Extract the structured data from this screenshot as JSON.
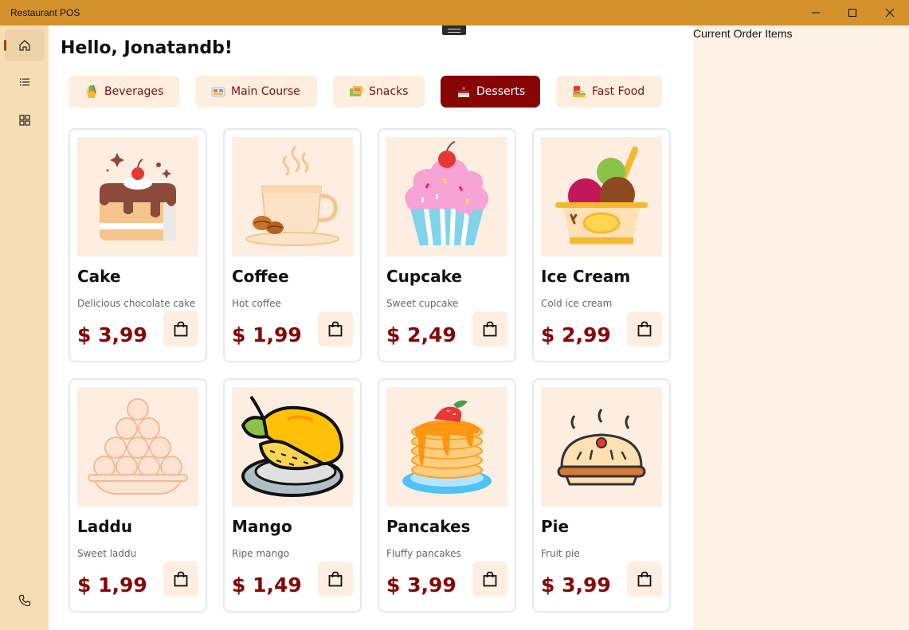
{
  "window": {
    "title": "Restaurant POS"
  },
  "header": {
    "greeting": "Hello, Jonatandb!"
  },
  "nav": [
    {
      "name": "home",
      "active": true
    },
    {
      "name": "list",
      "active": false
    },
    {
      "name": "grid",
      "active": false
    },
    {
      "name": "phone",
      "active": false
    }
  ],
  "categories": [
    {
      "label": "Beverages",
      "icon": "beverage-icon",
      "selected": false
    },
    {
      "label": "Main Course",
      "icon": "main-course-icon",
      "selected": false
    },
    {
      "label": "Snacks",
      "icon": "snacks-icon",
      "selected": false
    },
    {
      "label": "Desserts",
      "icon": "dessert-icon",
      "selected": true
    },
    {
      "label": "Fast Food",
      "icon": "fast-food-icon",
      "selected": false
    }
  ],
  "products": [
    {
      "name": "Cake",
      "description": "Delicious chocolate cake",
      "price": "$ 3,99",
      "icon": "cake-icon"
    },
    {
      "name": "Coffee",
      "description": "Hot coffee",
      "price": "$ 1,99",
      "icon": "coffee-icon"
    },
    {
      "name": "Cupcake",
      "description": "Sweet cupcake",
      "price": "$ 2,49",
      "icon": "cupcake-icon"
    },
    {
      "name": "Ice Cream",
      "description": "Cold ice cream",
      "price": "$ 2,99",
      "icon": "ice-cream-icon"
    },
    {
      "name": "Laddu",
      "description": "Sweet laddu",
      "price": "$ 1,99",
      "icon": "laddu-icon"
    },
    {
      "name": "Mango",
      "description": "Ripe mango",
      "price": "$ 1,49",
      "icon": "mango-icon"
    },
    {
      "name": "Pancakes",
      "description": "Fluffy pancakes",
      "price": "$ 3,99",
      "icon": "pancakes-icon"
    },
    {
      "name": "Pie",
      "description": "Fruit pie",
      "price": "$ 3,99",
      "icon": "pie-icon"
    }
  ],
  "order_panel": {
    "title": "Current Order Items"
  },
  "colors": {
    "titlebar": "#D3922B",
    "sidebar": "#F7DDB3",
    "accent": "#860606",
    "card_image_bg": "#FDEEE1",
    "order_panel_bg": "#FEF1E5"
  }
}
